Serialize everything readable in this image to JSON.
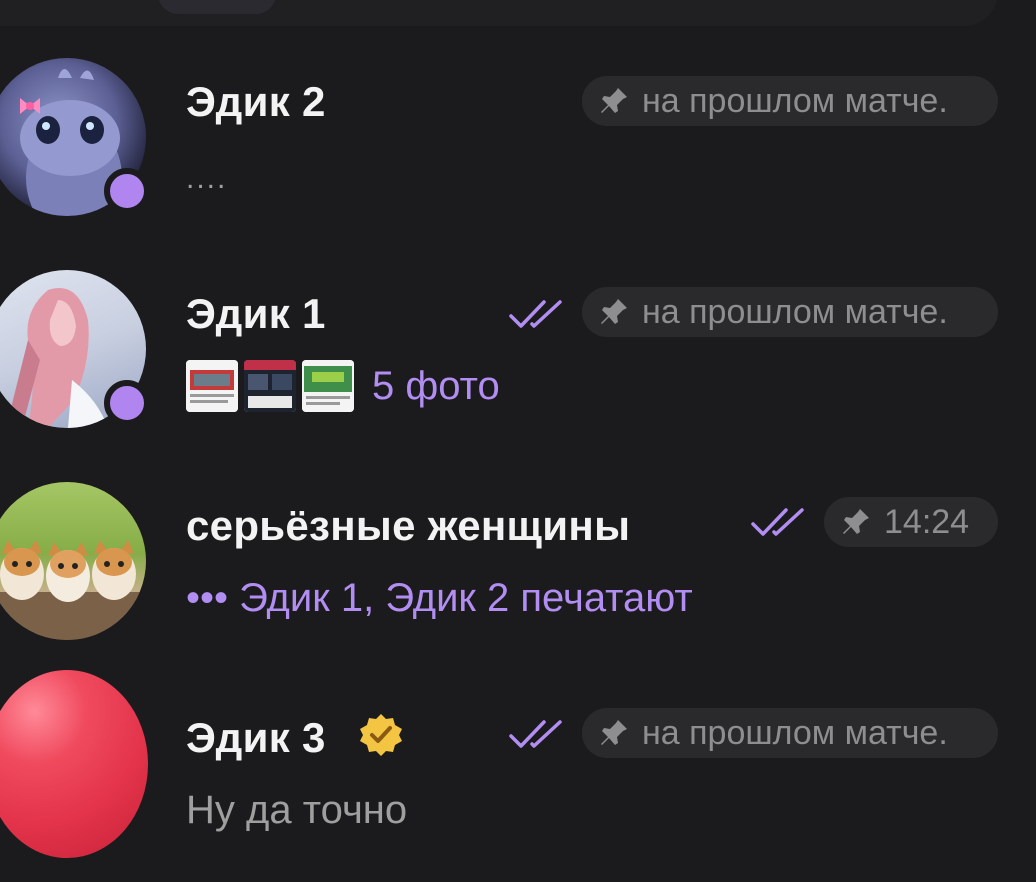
{
  "chats": [
    {
      "name": "Эдик 2",
      "preview": "....",
      "time": "на прошлом матче.",
      "online": true,
      "read": false
    },
    {
      "name": "Эдик 1",
      "preview": "5 фото",
      "time": "на прошлом матче.",
      "online": true,
      "read": true
    },
    {
      "name": "серьёзные женщины",
      "preview": "••• Эдик 1, Эдик 2 печатают",
      "time": "14:24",
      "online": false,
      "read": true
    },
    {
      "name": "Эдик 3",
      "preview": "Ну да точно",
      "time": "на прошлом матче.",
      "online": false,
      "read": true,
      "verified": true
    }
  ],
  "icons": {
    "pin": "pin-icon",
    "double_check": "double-check-icon",
    "verified": "verified-badge-icon"
  },
  "colors": {
    "background": "#1b1b1d",
    "accent": "#b085ef",
    "pill": "#2a2a2c",
    "muted_text": "#9f9f9f"
  }
}
